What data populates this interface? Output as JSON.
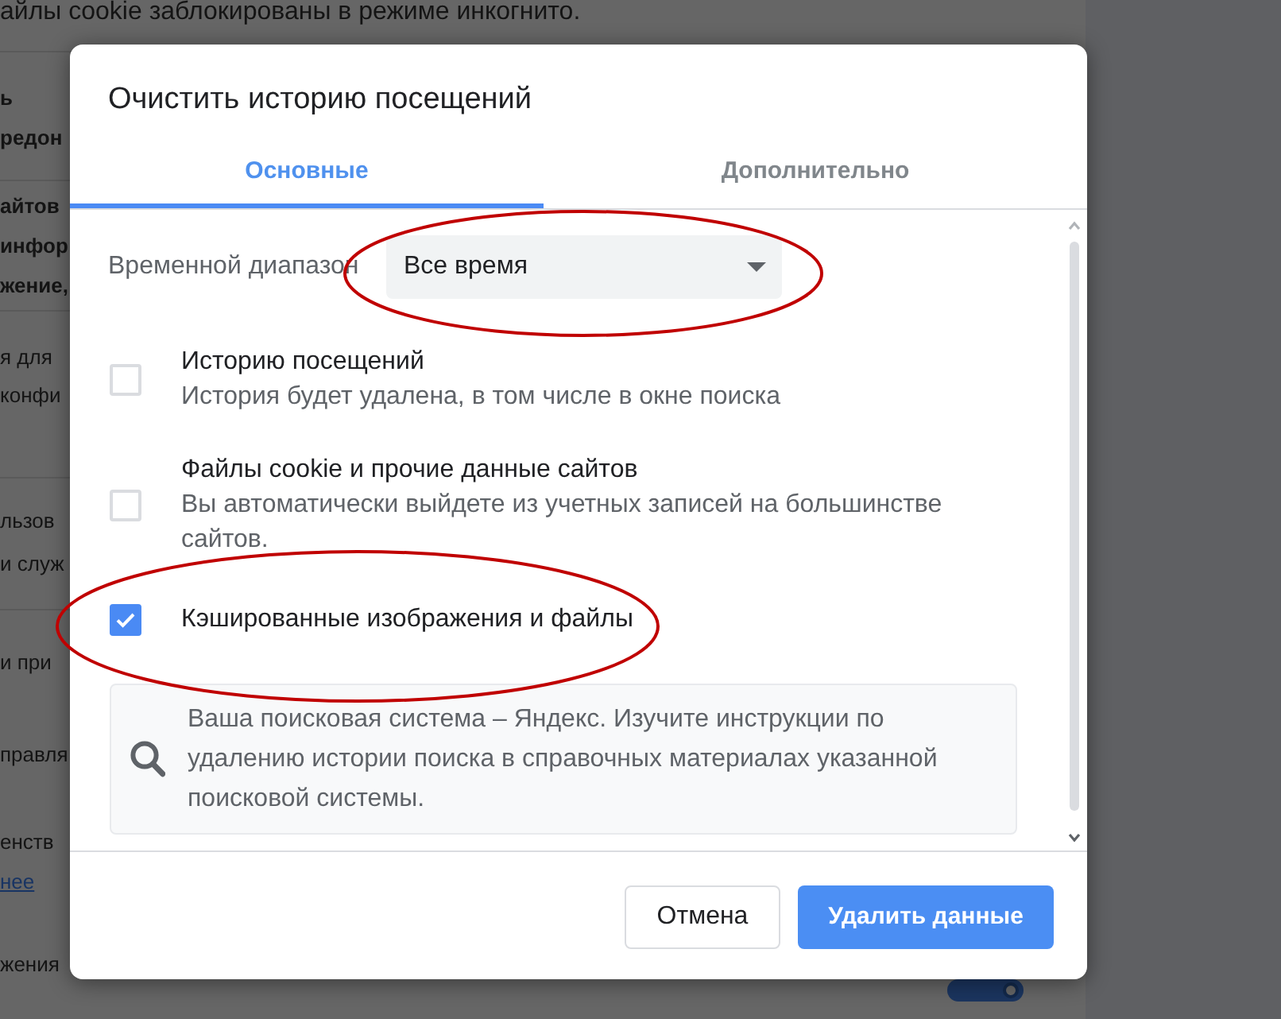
{
  "background_page": {
    "sections": [
      {
        "lines": [
          {
            "text": "айлы cookie заблокированы в режиме инкогнито.",
            "kind": "text",
            "bold": false
          }
        ]
      },
      {
        "lines": [
          {
            "text": "ь",
            "kind": "text",
            "bold": true
          },
          {
            "text": "редон",
            "kind": "text",
            "bold": true
          }
        ]
      },
      {
        "lines": [
          {
            "text": "айтов",
            "kind": "text",
            "bold": true
          },
          {
            "text": "инфор",
            "kind": "text",
            "bold": true
          },
          {
            "text": "жение,",
            "kind": "text",
            "bold": true
          }
        ]
      },
      {
        "lines": [
          {
            "text": "я для",
            "kind": "text",
            "bold": false
          },
          {
            "text": "конфи",
            "kind": "text",
            "bold": false
          }
        ]
      },
      {
        "lines": [
          {
            "text": "льзов",
            "kind": "text",
            "bold": false
          },
          {
            "text": "и служ",
            "kind": "text",
            "bold": false
          }
        ]
      },
      {
        "lines": [
          {
            "text": "и при",
            "kind": "text",
            "bold": false
          },
          {
            "text": "правля",
            "kind": "text",
            "bold": false
          },
          {
            "text": "енств",
            "kind": "text",
            "bold": false
          },
          {
            "text": "нее",
            "kind": "link",
            "bold": false
          },
          {
            "text": "жения",
            "kind": "text",
            "bold": false
          }
        ]
      }
    ],
    "toggle": {
      "on": true
    }
  },
  "dialog": {
    "title": "Очистить историю посещений",
    "tabs": [
      {
        "label": "Основные",
        "selected": true
      },
      {
        "label": "Дополнительно",
        "selected": false
      }
    ],
    "time_range": {
      "label": "Временной диапазон",
      "value": "Все время"
    },
    "options": [
      {
        "title": "Историю посещений",
        "description": "История будет удалена, в том числе в окне поиска",
        "checked": false
      },
      {
        "title": "Файлы cookie и прочие данные сайтов",
        "description": "Вы автоматически выйдете из учетных записей на большинстве сайтов.",
        "checked": false
      },
      {
        "title": "Кэшированные изображения и файлы",
        "checked": true
      }
    ],
    "notice": "Ваша поисковая система – Яндекс. Изучите инструкции по удалению истории поиска в справочных материалах указанной поисковой системы.",
    "buttons": [
      {
        "label": "Отмена",
        "kind": "secondary"
      },
      {
        "label": "Удалить данные",
        "kind": "primary"
      }
    ]
  },
  "annotations": [
    {
      "kind": "ellipse"
    },
    {
      "kind": "ellipse"
    }
  ]
}
